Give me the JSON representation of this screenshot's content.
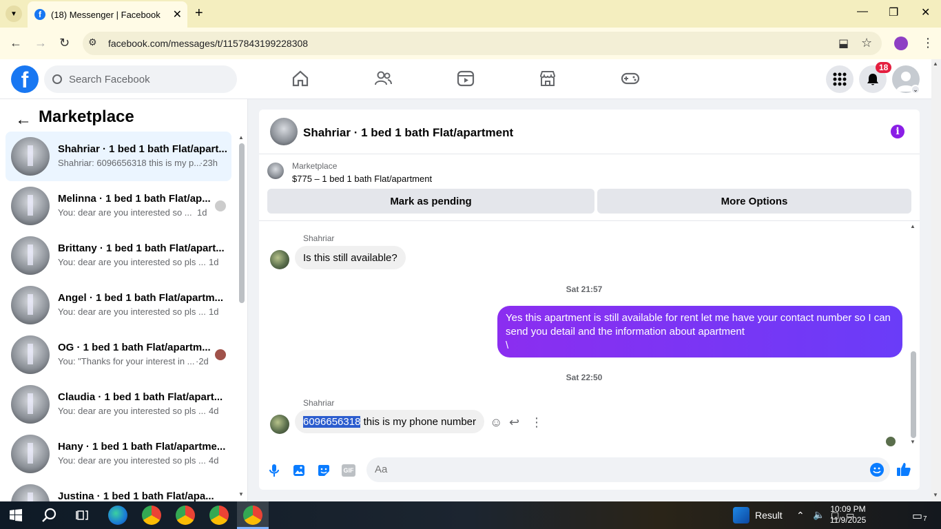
{
  "browser": {
    "tab_title": "(18) Messenger | Facebook",
    "url": "facebook.com/messages/t/1157843199228308"
  },
  "fb_header": {
    "search_placeholder": "Search Facebook",
    "notification_count": "18"
  },
  "sidebar": {
    "title": "Marketplace",
    "conversations": [
      {
        "name": "Shahriar · 1 bed 1 bath Flat/apart...",
        "snippet": "Shahriar: 6096656318 this is my p...",
        "time": "·23h"
      },
      {
        "name": "Melinna · 1 bed 1 bath Flat/ap...",
        "snippet": "You: dear are you interested so ...",
        "time": "1d"
      },
      {
        "name": "Brittany · 1 bed 1 bath Flat/apart...",
        "snippet": "You: dear are you interested so pls ...",
        "time": "1d"
      },
      {
        "name": "Angel · 1 bed 1 bath Flat/apartm...",
        "snippet": "You: dear are you interested so pls ...",
        "time": "1d"
      },
      {
        "name": "OG · 1 bed 1 bath Flat/apartm...",
        "snippet": "You: \"Thanks for your interest in ...",
        "time": "·2d"
      },
      {
        "name": "Claudia · 1 bed 1 bath Flat/apart...",
        "snippet": "You: dear are you interested so pls ...",
        "time": "4d"
      },
      {
        "name": "Hany · 1 bed 1 bath Flat/apartme...",
        "snippet": "You: dear are you interested so pls ...",
        "time": "4d"
      },
      {
        "name": "Justina · 1 bed 1 bath Flat/apa...",
        "snippet": "",
        "time": ""
      }
    ]
  },
  "chat": {
    "title": "Shahriar · 1 bed 1 bath Flat/apartment",
    "marketplace_label": "Marketplace",
    "listing": "$775 – 1 bed 1 bath Flat/apartment",
    "mark_pending": "Mark as pending",
    "more_options": "More Options",
    "messages": [
      {
        "sender": "Shahriar",
        "text": "Is this still available?"
      },
      {
        "timestamp": "Sat 21:57"
      },
      {
        "text_line1": "Yes this apartment is still available for rent let me have your contact number so I can",
        "text_line2": "send you detail and the information about apartment",
        "text_line3": "\\"
      },
      {
        "timestamp": "Sat 22:50"
      },
      {
        "sender": "Shahriar",
        "selected": "6096656318",
        "rest": " this is my phone number"
      }
    ],
    "composer_placeholder": "Aa"
  },
  "taskbar": {
    "result_label": "Result",
    "time": "10:09 PM",
    "date": "11/9/2025",
    "notif_count": "7"
  },
  "colors": {
    "fb_blue": "#1877f2",
    "outgoing_bubble": "#7b2ff7",
    "selection": "#2b5cce"
  }
}
